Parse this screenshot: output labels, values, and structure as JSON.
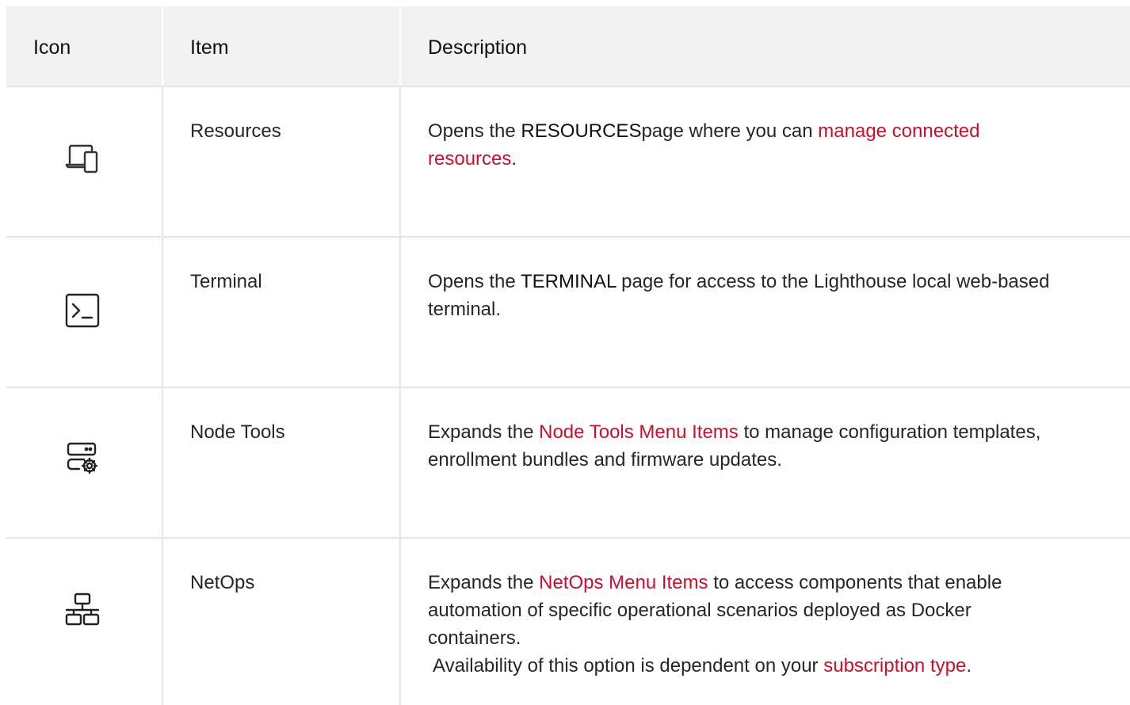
{
  "header": {
    "icon_col": "Icon",
    "item_col": "Item",
    "desc_col": "Description"
  },
  "rows": [
    {
      "icon": "devices-icon",
      "item": "Resources",
      "desc_pre": "Opens the ",
      "desc_bold": "RESOURCES",
      "desc_mid": "page where you can ",
      "desc_link": "manage connected resources",
      "desc_post": "."
    },
    {
      "icon": "terminal-icon",
      "item": "Terminal",
      "desc_pre": "Opens the ",
      "desc_bold": "TERMINAL",
      "desc_post": " page for access to the Lighthouse local web-based terminal."
    },
    {
      "icon": "server-gear-icon",
      "item": "Node Tools",
      "desc_pre": "Expands the ",
      "desc_link": "Node Tools Menu Items",
      "desc_post": " to manage configuration templates, enrollment bundles and firmware updates."
    },
    {
      "icon": "network-icon",
      "item": "NetOps",
      "desc_pre": "Expands the ",
      "desc_link": "NetOps Menu Items",
      "desc_post": " to access components that enable automation of specific operational scenarios deployed as Docker containers.",
      "note_pre": "Availability of this option is dependent on your ",
      "note_link": "subscription type",
      "note_post": "."
    }
  ],
  "colors": {
    "link": "#c8102e",
    "header_bg": "#f2f2f2",
    "border": "#e4e4e4"
  }
}
